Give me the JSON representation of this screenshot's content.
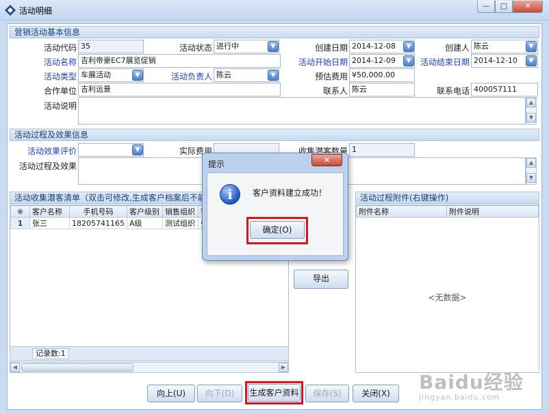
{
  "window": {
    "title": "活动明细",
    "min_glyph": "—",
    "max_glyph": "□",
    "close_glyph": "✕"
  },
  "basic": {
    "header": "营销活动基本信息",
    "code_label": "活动代码",
    "code_value": "35",
    "status_label": "活动状态",
    "status_value": "进行中",
    "created_date_label": "创建日期",
    "created_date_value": "2014-12-08",
    "creator_label": "创建人",
    "creator_value": "陈云",
    "name_label": "活动名称",
    "name_value": "吉利帝豪EC7展览促销",
    "start_date_label": "活动开始日期",
    "start_date_value": "2014-12-09",
    "end_date_label": "活动结束日期",
    "end_date_value": "2014-12-10",
    "type_label": "活动类型",
    "type_value": "车展活动",
    "owner_label": "活动负责人",
    "owner_value": "陈云",
    "budget_label": "预估费用",
    "budget_value": "¥50,000.00",
    "partner_label": "合作单位",
    "partner_value": "吉利远景",
    "contact_label": "联系人",
    "contact_value": "陈云",
    "phone_label": "联系电话",
    "phone_value": "400057111",
    "desc_label": "活动说明",
    "desc_value": ""
  },
  "process": {
    "header": "活动过程及效果信息",
    "eval_label": "活动效果评价",
    "eval_value": "",
    "actual_cost_label": "实际费用",
    "actual_cost_value": "",
    "collected_label": "收集潜客数量",
    "collected_value": "1",
    "effect_label": "活动过程及效果",
    "effect_value": ""
  },
  "prospects": {
    "header": "活动收集潜客清单（双击可修改,生成客户档案后不能",
    "columns": [
      "※",
      "客户名称",
      "手机号码",
      "客户级别",
      "销售组织",
      "销"
    ],
    "rows": [
      [
        "1",
        "张三",
        "18205741165",
        "A级",
        "测试组织",
        "张"
      ]
    ],
    "record_count": "记录数:1"
  },
  "side_buttons": {
    "export": "导出"
  },
  "attachments": {
    "header": "活动过程附件(右键操作)",
    "columns": [
      "附件名称",
      "附件说明"
    ],
    "empty_text": "<无数据>"
  },
  "bottom_buttons": {
    "prev": "向上(U)",
    "next": "向下(D)",
    "generate": "生成客户资料",
    "save": "保存(S)",
    "close": "关闭(X)"
  },
  "dialog": {
    "title": "提示",
    "message": "客户资料建立成功！",
    "ok": "确定(O)",
    "close_glyph": "✕",
    "info_glyph": "i"
  },
  "watermark": {
    "logo": "Baidu经验",
    "sub": "jingyan.baidu.com"
  },
  "colors": {
    "highlight": "#e0121c",
    "link_label": "#1a3fcf",
    "section_text": "#1c3f75"
  },
  "icons": {
    "app": "app-logo-icon",
    "dropdown": "chevron-down-icon",
    "info": "info-icon"
  }
}
